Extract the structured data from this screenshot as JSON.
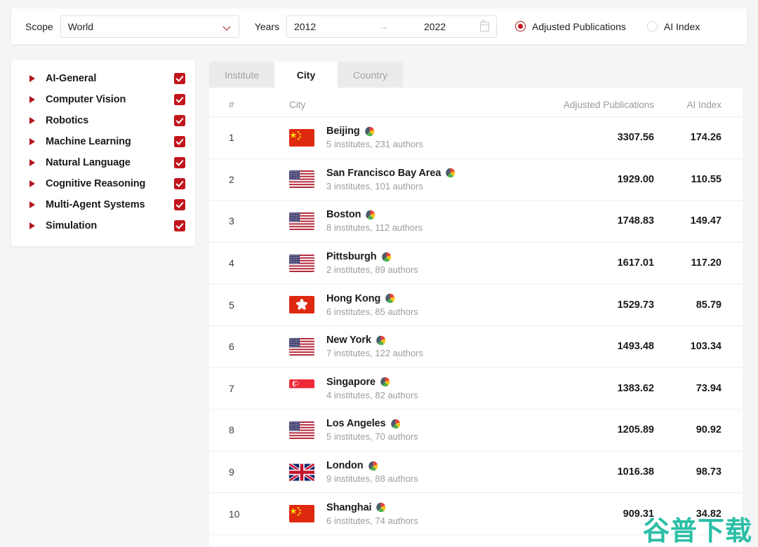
{
  "filters": {
    "scope_label": "Scope",
    "scope_value": "World",
    "years_label": "Years",
    "year_from": "2012",
    "year_to": "2022",
    "range_arrow": "→",
    "metric_options": [
      {
        "label": "Adjusted Publications",
        "selected": true
      },
      {
        "label": "AI Index",
        "selected": false
      }
    ]
  },
  "sidebar": {
    "items": [
      {
        "label": "AI-General",
        "checked": true
      },
      {
        "label": "Computer Vision",
        "checked": true
      },
      {
        "label": "Robotics",
        "checked": true
      },
      {
        "label": "Machine Learning",
        "checked": true
      },
      {
        "label": "Natural Language",
        "checked": true
      },
      {
        "label": "Cognitive Reasoning",
        "checked": true
      },
      {
        "label": "Multi-Agent Systems",
        "checked": true
      },
      {
        "label": "Simulation",
        "checked": true
      }
    ]
  },
  "tabs": [
    {
      "label": "Institute",
      "active": false
    },
    {
      "label": "City",
      "active": true
    },
    {
      "label": "Country",
      "active": false
    }
  ],
  "table": {
    "columns": [
      "#",
      "City",
      "Adjusted Publications",
      "AI Index"
    ],
    "rows": [
      {
        "rank": "1",
        "flag": "cn",
        "city": "Beijing",
        "sub": "5 institutes, 231 authors",
        "pub": "3307.56",
        "idx": "174.26"
      },
      {
        "rank": "2",
        "flag": "us",
        "city": "San Francisco Bay Area",
        "sub": "3 institutes, 101 authors",
        "pub": "1929.00",
        "idx": "110.55"
      },
      {
        "rank": "3",
        "flag": "us",
        "city": "Boston",
        "sub": "8 institutes, 112 authors",
        "pub": "1748.83",
        "idx": "149.47"
      },
      {
        "rank": "4",
        "flag": "us",
        "city": "Pittsburgh",
        "sub": "2 institutes, 89 authors",
        "pub": "1617.01",
        "idx": "117.20"
      },
      {
        "rank": "5",
        "flag": "hk",
        "city": "Hong Kong",
        "sub": "6 institutes, 85 authors",
        "pub": "1529.73",
        "idx": "85.79"
      },
      {
        "rank": "6",
        "flag": "us",
        "city": "New York",
        "sub": "7 institutes, 122 authors",
        "pub": "1493.48",
        "idx": "103.34"
      },
      {
        "rank": "7",
        "flag": "sg",
        "city": "Singapore",
        "sub": "4 institutes, 82 authors",
        "pub": "1383.62",
        "idx": "73.94"
      },
      {
        "rank": "8",
        "flag": "us",
        "city": "Los Angeles",
        "sub": "5 institutes, 70 authors",
        "pub": "1205.89",
        "idx": "90.92"
      },
      {
        "rank": "9",
        "flag": "gb",
        "city": "London",
        "sub": "9 institutes, 88 authors",
        "pub": "1016.38",
        "idx": "98.73"
      },
      {
        "rank": "10",
        "flag": "cn",
        "city": "Shanghai",
        "sub": "6 institutes, 74 authors",
        "pub": "909.31",
        "idx": "34.82"
      }
    ]
  },
  "watermark": {
    "text": "谷普下载"
  },
  "colors": {
    "accent_red": "#c1161c",
    "watermark_teal": "#2bbfa6",
    "panel_bg": "#ffffff",
    "page_bg": "#f5f5f5"
  }
}
